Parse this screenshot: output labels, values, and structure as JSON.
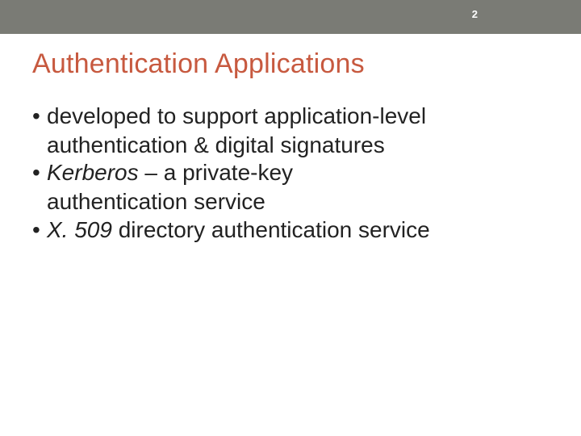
{
  "page_number": "2",
  "title": "Authentication Applications",
  "bullets": {
    "b1_part1": "developed to support application-level",
    "b1_cont": "authentication & digital signatures",
    "b2_em": "Kerberos",
    "b2_rest": " – a private-key",
    "b2_cont": "authentication service",
    "b3_em": "X. 509",
    "b3_rest": " directory authentication service"
  }
}
